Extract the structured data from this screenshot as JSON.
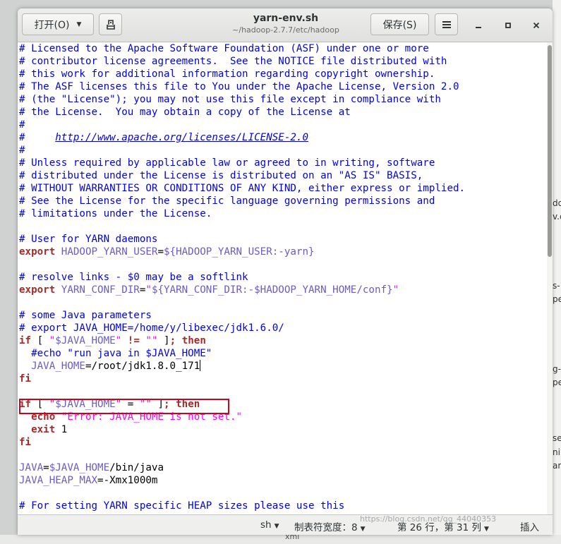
{
  "window": {
    "title": "yarn-env.sh",
    "subtitle": "~/hadoop-2.7.7/etc/hadoop",
    "open_label": "打开(O)",
    "save_label": "保存(S)"
  },
  "code_lines": [
    [
      [
        "c",
        "# Licensed to the Apache Software Foundation (ASF) under one or more"
      ]
    ],
    [
      [
        "c",
        "# contributor license agreements.  See the NOTICE file distributed with"
      ]
    ],
    [
      [
        "c",
        "# this work for additional information regarding copyright ownership."
      ]
    ],
    [
      [
        "c",
        "# The ASF licenses this file to You under the Apache License, Version 2.0"
      ]
    ],
    [
      [
        "c",
        "# (the \"License\"); you may not use this file except in compliance with"
      ]
    ],
    [
      [
        "c",
        "# the License.  You may obtain a copy of the License at"
      ]
    ],
    [
      [
        "c",
        "#"
      ]
    ],
    [
      [
        "c",
        "#     "
      ],
      [
        "link",
        "http://www.apache.org/licenses/LICENSE-2.0"
      ]
    ],
    [
      [
        "c",
        "#"
      ]
    ],
    [
      [
        "c",
        "# Unless required by applicable law or agreed to in writing, software"
      ]
    ],
    [
      [
        "c",
        "# distributed under the License is distributed on an \"AS IS\" BASIS,"
      ]
    ],
    [
      [
        "c",
        "# WITHOUT WARRANTIES OR CONDITIONS OF ANY KIND, either express or implied."
      ]
    ],
    [
      [
        "c",
        "# See the License for the specific language governing permissions and"
      ]
    ],
    [
      [
        "c",
        "# limitations under the License."
      ]
    ],
    [],
    [
      [
        "c",
        "# User for YARN daemons"
      ]
    ],
    [
      [
        "kw",
        "export"
      ],
      [
        "t",
        " "
      ],
      [
        "var",
        "HADOOP_YARN_USER"
      ],
      [
        "t",
        "="
      ],
      [
        "var",
        "${HADOOP_YARN_USER:-yarn}"
      ]
    ],
    [],
    [
      [
        "c",
        "# resolve links - $0 may be a softlink"
      ]
    ],
    [
      [
        "kw",
        "export"
      ],
      [
        "t",
        " "
      ],
      [
        "var",
        "YARN_CONF_DIR"
      ],
      [
        "t",
        "="
      ],
      [
        "str",
        "\""
      ],
      [
        "var",
        "${YARN_CONF_DIR:-$HADOOP_YARN_HOME/conf}"
      ],
      [
        "str",
        "\""
      ]
    ],
    [],
    [
      [
        "c",
        "# some Java parameters"
      ]
    ],
    [
      [
        "c",
        "# export JAVA_HOME=/home/y/libexec/jdk1.6.0/"
      ]
    ],
    [
      [
        "kw",
        "if"
      ],
      [
        "t",
        " [ "
      ],
      [
        "str",
        "\""
      ],
      [
        "var",
        "$JAVA_HOME"
      ],
      [
        "str",
        "\""
      ],
      [
        "t",
        " "
      ],
      [
        "kw",
        "!="
      ],
      [
        "t",
        " "
      ],
      [
        "str",
        "\"\""
      ],
      [
        "t",
        " ]"
      ],
      [
        "kw",
        "; then"
      ]
    ],
    [
      [
        "t",
        "  "
      ],
      [
        "c",
        "#echo \"run java in $JAVA_HOME\""
      ]
    ],
    [
      [
        "t",
        "  "
      ],
      [
        "var",
        "JAVA_HOME"
      ],
      [
        "t",
        "=/root/jdk1.8.0_171"
      ],
      [
        "cursor",
        ""
      ]
    ],
    [
      [
        "kw",
        "fi"
      ]
    ],
    [],
    [
      [
        "kw",
        "if"
      ],
      [
        "t",
        " [ "
      ],
      [
        "str",
        "\""
      ],
      [
        "var",
        "$JAVA_HOME"
      ],
      [
        "str",
        "\""
      ],
      [
        "t",
        " = "
      ],
      [
        "str",
        "\"\""
      ],
      [
        "t",
        " ]"
      ],
      [
        "kw",
        "; then"
      ]
    ],
    [
      [
        "t",
        "  "
      ],
      [
        "kw",
        "echo"
      ],
      [
        "t",
        " "
      ],
      [
        "str",
        "\"Error: JAVA_HOME is not set.\""
      ]
    ],
    [
      [
        "t",
        "  "
      ],
      [
        "kw",
        "exit"
      ],
      [
        "t",
        " 1"
      ]
    ],
    [
      [
        "kw",
        "fi"
      ]
    ],
    [],
    [
      [
        "var",
        "JAVA"
      ],
      [
        "t",
        "="
      ],
      [
        "var",
        "$JAVA_HOME"
      ],
      [
        "t",
        "/bin/java"
      ]
    ],
    [
      [
        "var",
        "JAVA_HEAP_MAX"
      ],
      [
        "t",
        "=-Xmx1000m"
      ]
    ],
    [],
    [
      [
        "c",
        "# For setting YARN specific HEAP sizes please use this"
      ]
    ]
  ],
  "status": {
    "language": "sh",
    "tab_width": "制表符宽度：8",
    "position": "第 26 行，第 31 列",
    "mode": "插入"
  },
  "watermark": "https://blog.csdn.net/qq_44040353",
  "background": {
    "texts": [
      "do",
      "v.c",
      "s-",
      "pe",
      "g-",
      "pe",
      "se",
      "ni",
      "am",
      "xml"
    ]
  },
  "icons": {
    "open_dropdown": "chevron-down-icon",
    "new_document": "new-document-icon",
    "menu": "hamburger-menu-icon",
    "minimize": "minimize-icon",
    "maximize": "maximize-icon",
    "close": "close-icon"
  },
  "colors": {
    "comment": "#0000ee",
    "keyword": "#a52a2a",
    "variable": "#6a5acd",
    "string": "#ff00ff",
    "highlight_box": "#d0021b"
  }
}
